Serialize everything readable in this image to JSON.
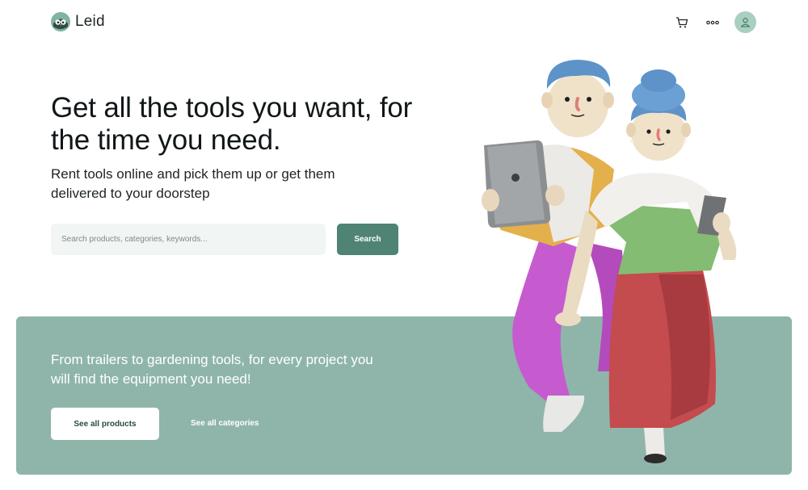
{
  "header": {
    "brand_name": "Leid",
    "icons": [
      "owl-logo-icon",
      "cart-icon",
      "more-dots-icon",
      "user-icon"
    ]
  },
  "hero": {
    "title": "Get all the tools you want, for the time you need.",
    "subtitle": "Rent tools online and pick them up or get them delivered to your doorstep"
  },
  "search": {
    "placeholder": "Search products, categories, keywords...",
    "value": "",
    "button_label": "Search"
  },
  "banner": {
    "text": "From trailers to gardening tools, for every project you will find the equipment you need!",
    "products_button_label": "See all products",
    "categories_link_label": "See all categories"
  },
  "colors": {
    "accent": "#4f8373",
    "banner_bg": "#8fb5aa",
    "avatar_bg": "#a9cfc1",
    "input_bg": "#f1f5f4"
  }
}
